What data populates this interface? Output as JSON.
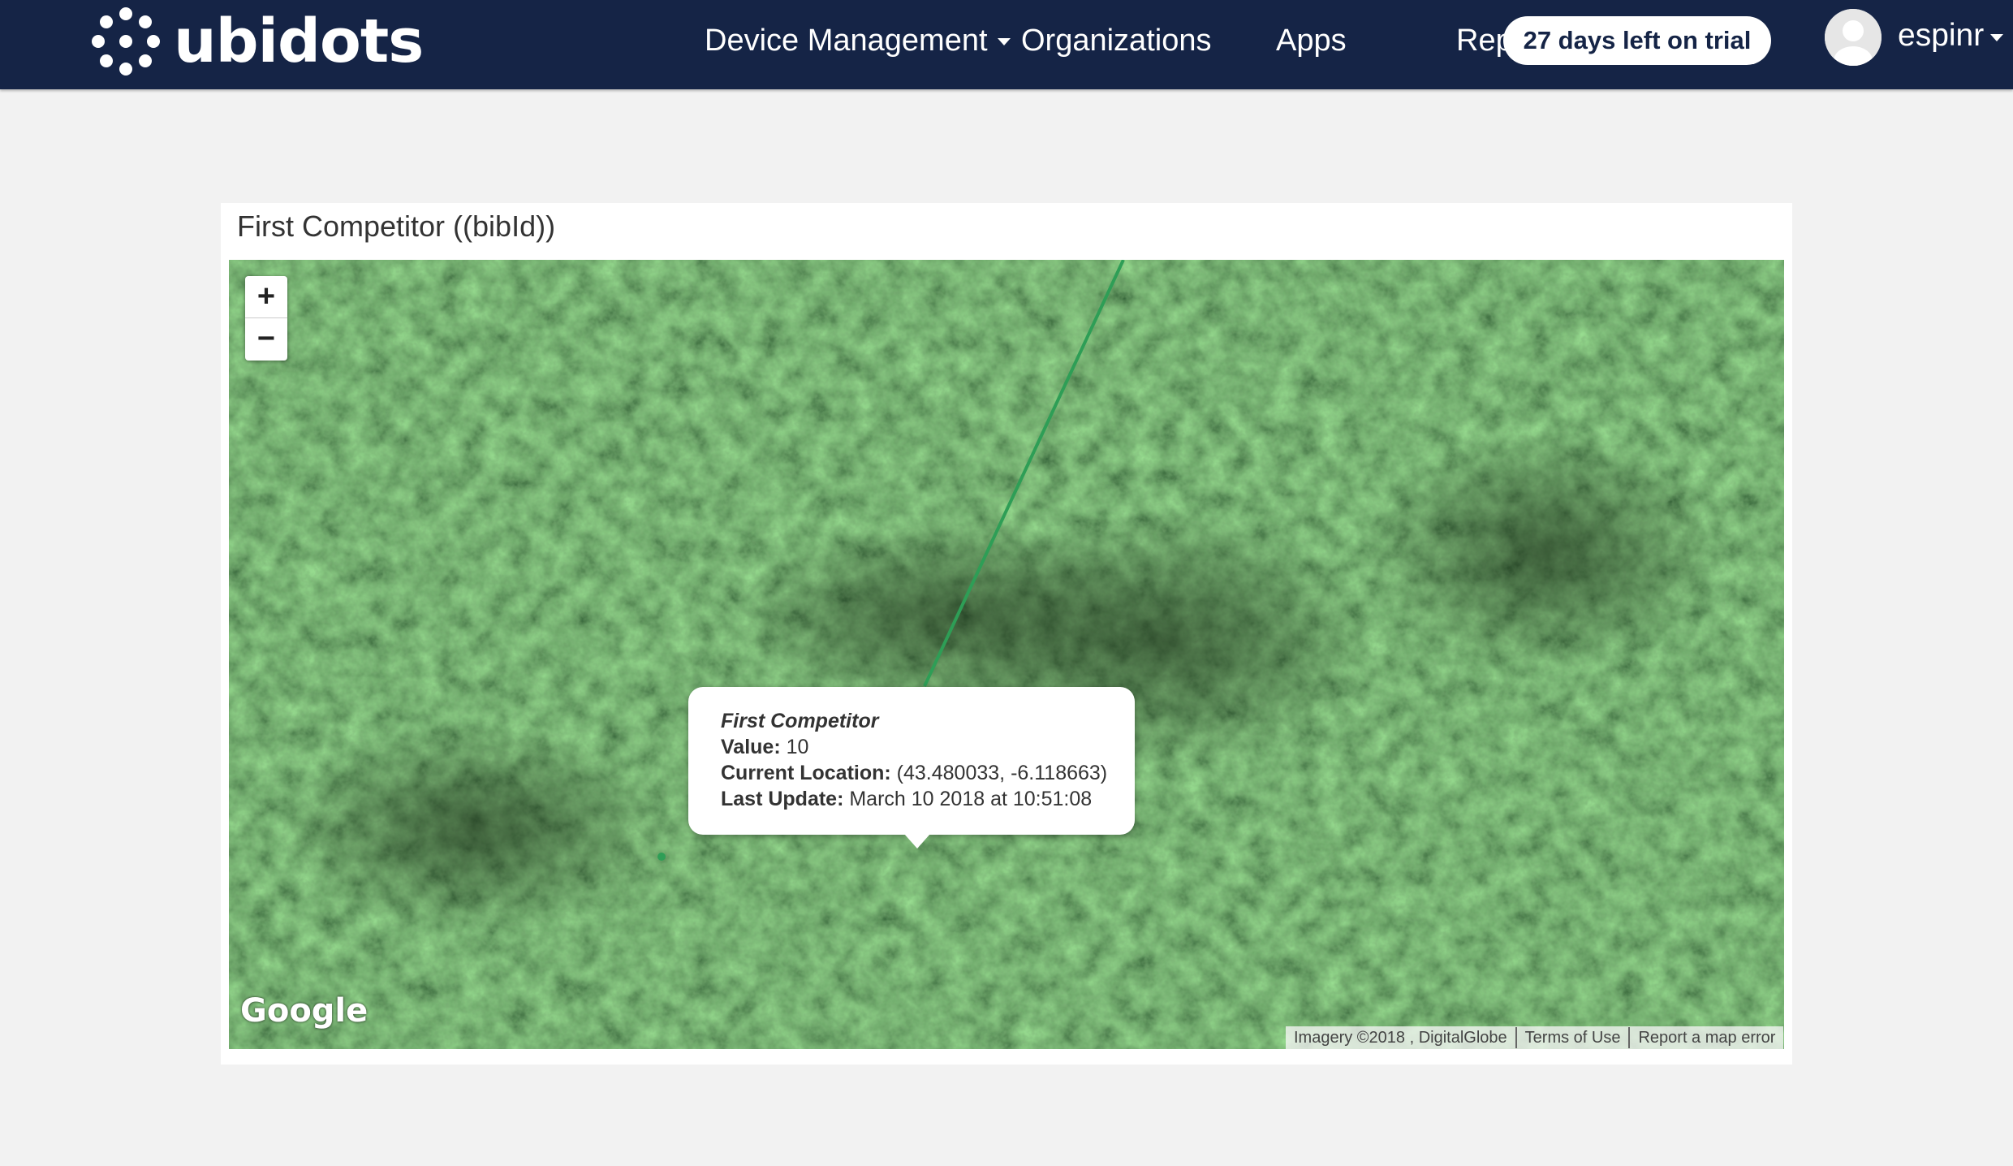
{
  "navbar": {
    "brand": "ubidots",
    "items": [
      {
        "label": "Device Management"
      },
      {
        "label": "Organizations"
      },
      {
        "label": "Apps"
      },
      {
        "label": "Rep"
      }
    ],
    "trial_badge": "27 days left on trial",
    "user": {
      "name": "espinr"
    }
  },
  "widget": {
    "title": "First Competitor ((bibId))",
    "map": {
      "zoom_in": "+",
      "zoom_out": "−",
      "popup": {
        "name": "First Competitor",
        "value_label": "Value:",
        "value": "10",
        "location_label": "Current Location:",
        "location": "(43.480033, -6.118663)",
        "update_label": "Last Update:",
        "update": "March 10 2018 at 10:51:08"
      },
      "provider_logo": "Google",
      "attribution": {
        "imagery": "Imagery ©2018 , DigitalGlobe",
        "terms": "Terms of Use",
        "report": "Report a map error"
      },
      "track_color": "#2e9e56"
    }
  }
}
